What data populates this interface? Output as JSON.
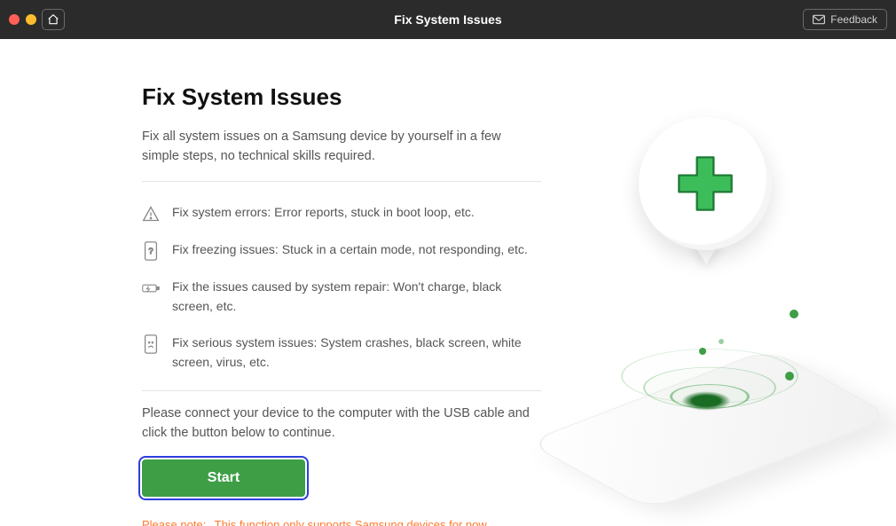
{
  "titlebar": {
    "title": "Fix System Issues",
    "feedback_label": "Feedback"
  },
  "page": {
    "heading": "Fix System Issues",
    "intro": "Fix all system issues on a Samsung device by yourself in a few simple steps, no technical skills required."
  },
  "features": [
    {
      "text": "Fix system errors: Error reports, stuck in boot loop, etc."
    },
    {
      "text": "Fix freezing issues: Stuck in a certain mode, not responding, etc."
    },
    {
      "text": "Fix the issues caused by system repair: Won't charge, black screen, etc."
    },
    {
      "text": "Fix serious system issues: System crashes, black screen, white screen, virus, etc."
    }
  ],
  "connect_text": "Please connect your device to the computer with the USB cable and click the button below to continue.",
  "start_label": "Start",
  "note": {
    "label": "Please note:",
    "text": "This function only supports Samsung devices for now."
  },
  "colors": {
    "accent_green": "#3d9e46",
    "focus_blue": "#2e3fdc",
    "warn_orange": "#ff7a2f"
  }
}
